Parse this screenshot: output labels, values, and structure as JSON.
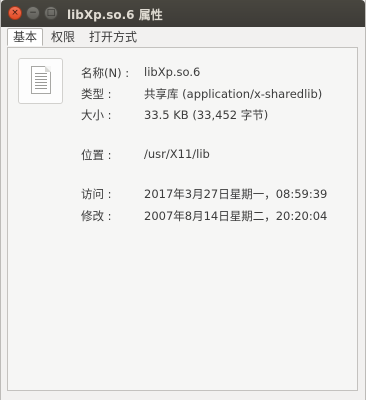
{
  "window": {
    "title": "libXp.so.6 属性",
    "buttons": {
      "close": "×",
      "minimize": "−",
      "maximize": "□"
    }
  },
  "tabs": [
    {
      "label": "基本",
      "active": true
    },
    {
      "label": "权限",
      "active": false
    },
    {
      "label": "打开方式",
      "active": false
    }
  ],
  "icon": "document-icon",
  "properties": {
    "name": {
      "label": "名称(N) :",
      "value": "libXp.so.6"
    },
    "type": {
      "label": "类型 :",
      "value": "共享库 (application/x-sharedlib)"
    },
    "size": {
      "label": "大小 :",
      "value": "33.5 KB (33,452 字节)"
    },
    "location": {
      "label": "位置 :",
      "value": "/usr/X11/lib"
    },
    "accessed": {
      "label": "访问 :",
      "value": "2017年3月27日星期一，08:59:39"
    },
    "modified": {
      "label": "修改 :",
      "value": "2007年8月14日星期二，20:20:04"
    }
  },
  "colors": {
    "titlebar": "#3c3b37",
    "close_button": "#e95420",
    "title_text": "#dfdbd2"
  }
}
